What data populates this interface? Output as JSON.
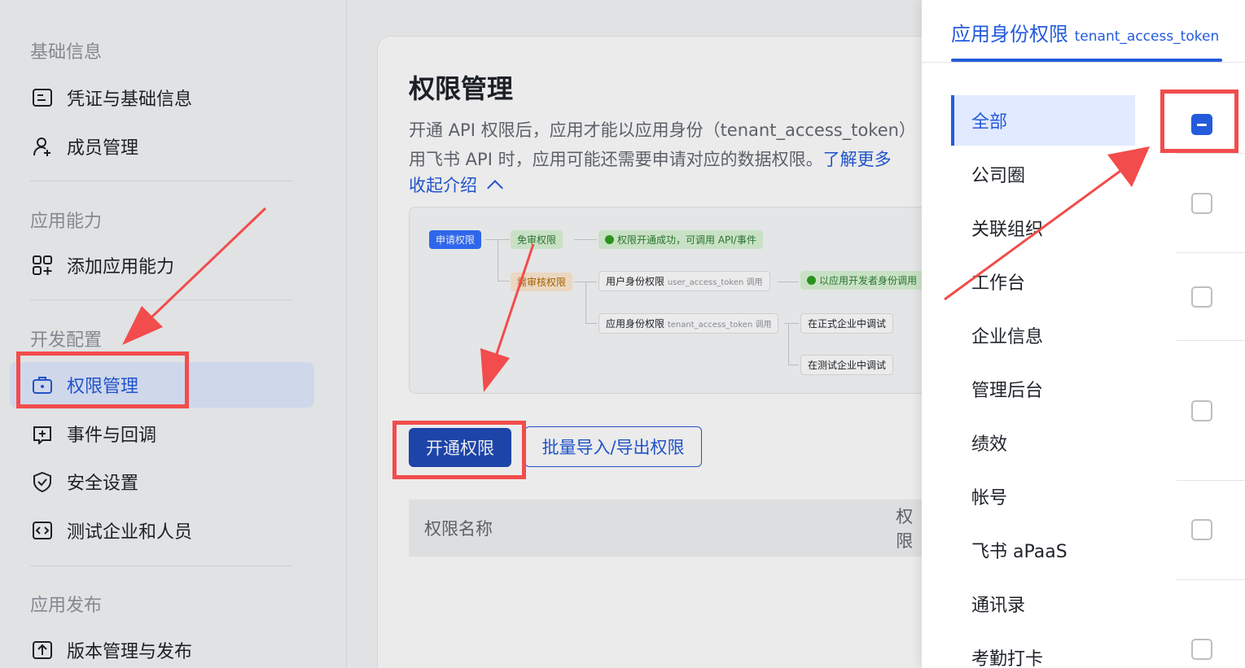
{
  "sidebar": {
    "sections": [
      {
        "title": "基础信息",
        "items": [
          "凭证与基础信息",
          "成员管理"
        ]
      },
      {
        "title": "应用能力",
        "items": [
          "添加应用能力"
        ]
      },
      {
        "title": "开发配置",
        "items": [
          "权限管理",
          "事件与回调",
          "安全设置",
          "测试企业和人员"
        ]
      },
      {
        "title": "应用发布",
        "items": [
          "版本管理与发布"
        ]
      }
    ],
    "active_item": "权限管理"
  },
  "main": {
    "title": "权限管理",
    "desc_line1": "开通 API 权限后，应用才能以应用身份（tenant_access_token）",
    "desc_line2": "用飞书 API 时，应用可能还需要申请对应的数据权限。",
    "learn_more": "了解更多",
    "collapse": "收起介绍",
    "flow": {
      "apply": "申请权限",
      "free": "免审权限",
      "free_result": "权限开通成功，可调用 API/事件",
      "review": "需审核权限",
      "user_perm": "用户身份权限",
      "user_token": "user_access_token 调用",
      "user_result": "以应用开发者身份调用",
      "app_perm": "应用身份权限",
      "app_token": "tenant_access_token 调用",
      "prod_debug": "在正式企业中调试",
      "test_debug": "在测试企业中调试"
    },
    "btn_enable": "开通权限",
    "btn_batch": "批量导入/导出权限",
    "table_col1": "权限名称",
    "table_col2": "权限"
  },
  "drawer": {
    "tab_label": "应用身份权限",
    "tab_token": "tenant_access_token",
    "categories": [
      "全部",
      "公司圈",
      "关联组织",
      "工作台",
      "企业信息",
      "管理后台",
      "绩效",
      "帐号",
      "飞书 aPaaS",
      "通讯录",
      "考勤打卡"
    ],
    "active_category": "全部"
  },
  "colors": {
    "accent": "#245bdb",
    "annotation": "#f24c4c",
    "active_bg": "#e1eaff"
  }
}
